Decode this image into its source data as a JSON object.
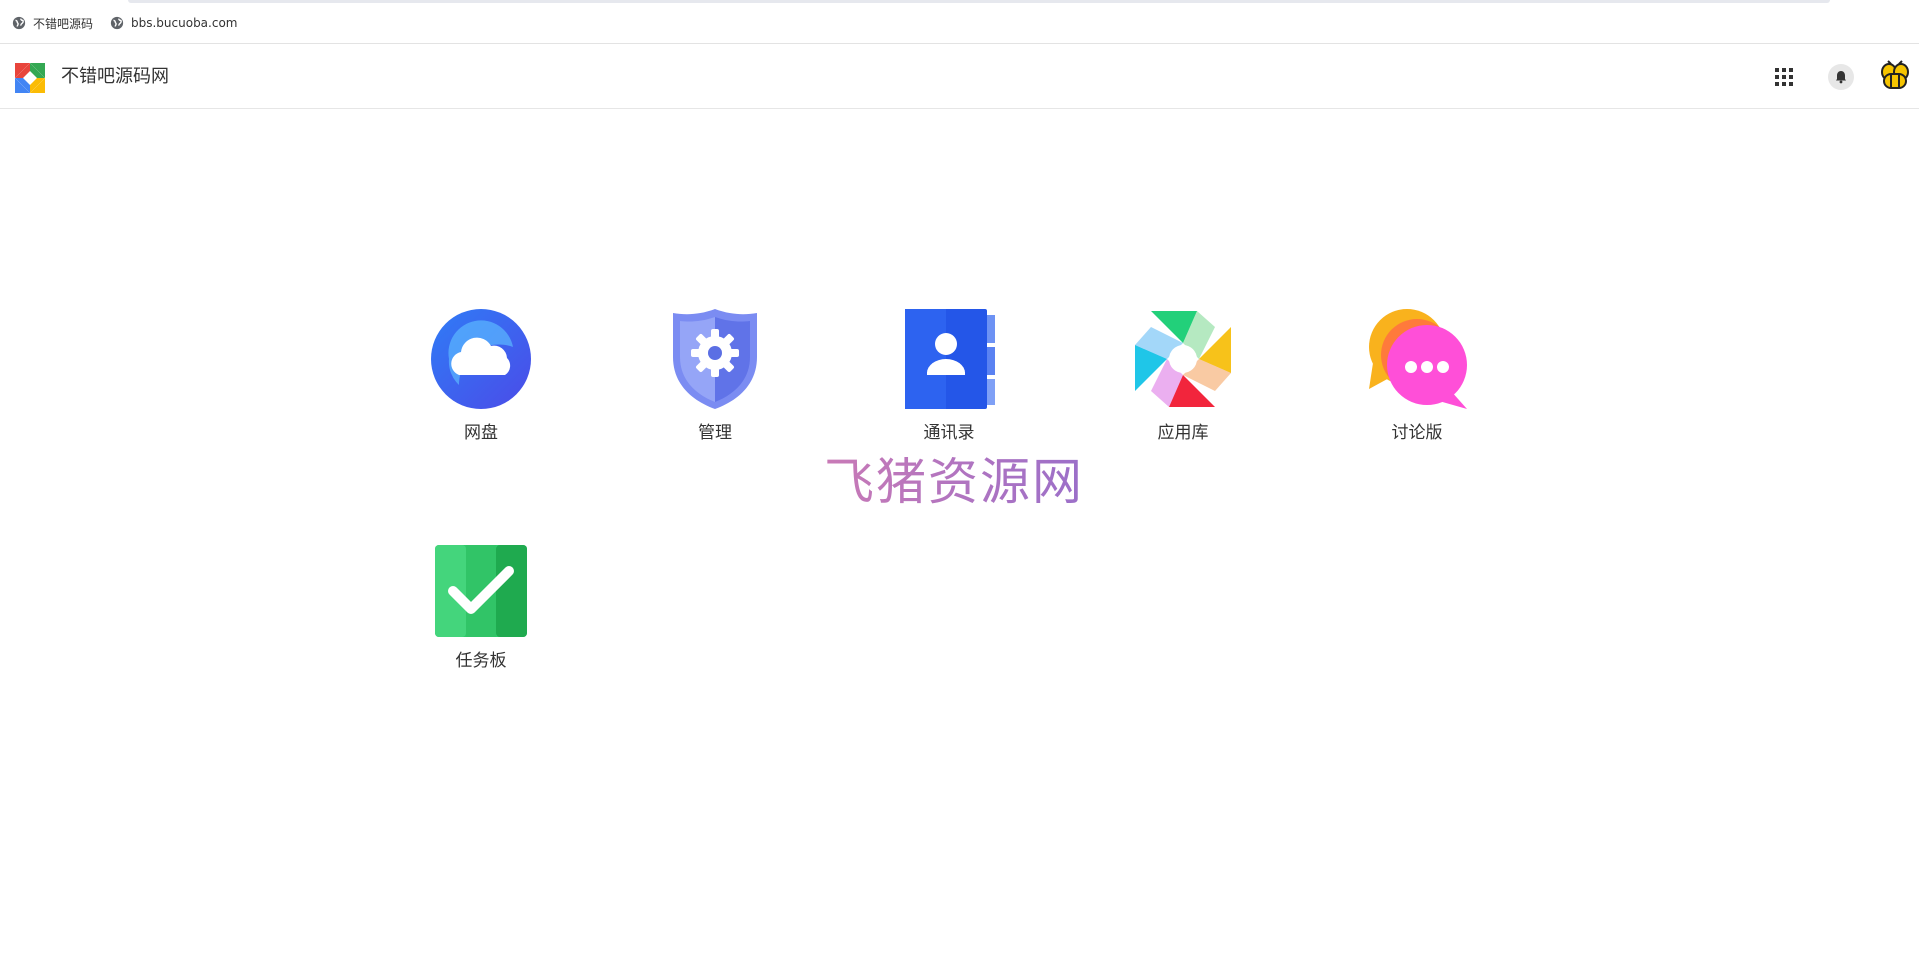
{
  "bookmarks": [
    {
      "label": "不错吧源码",
      "icon": "globe-icon"
    },
    {
      "label": "bbs.bucuoba.com",
      "icon": "globe-icon"
    }
  ],
  "header": {
    "site_name": "不错吧源码网",
    "icons": [
      "logo-icon",
      "apps-grid-icon",
      "bell-icon",
      "avatar-bee-icon"
    ]
  },
  "apps": [
    {
      "label": "网盘",
      "icon": "cloud-drive-icon"
    },
    {
      "label": "管理",
      "icon": "admin-shield-icon"
    },
    {
      "label": "通讯录",
      "icon": "contacts-book-icon"
    },
    {
      "label": "应用库",
      "icon": "app-store-pinwheel-icon"
    },
    {
      "label": "讨论版",
      "icon": "forum-chat-icon"
    },
    {
      "label": "任务板",
      "icon": "task-board-check-icon"
    }
  ],
  "watermark": "飞猪资源网",
  "colors": {
    "drive_blue": "#2f80ff",
    "admin_purple": "#6f80f0",
    "contacts_blue": "#2456e8",
    "forum_pink": "#ff4fd8",
    "tasks_green": "#22c55e",
    "watermark": "#b079c4"
  }
}
